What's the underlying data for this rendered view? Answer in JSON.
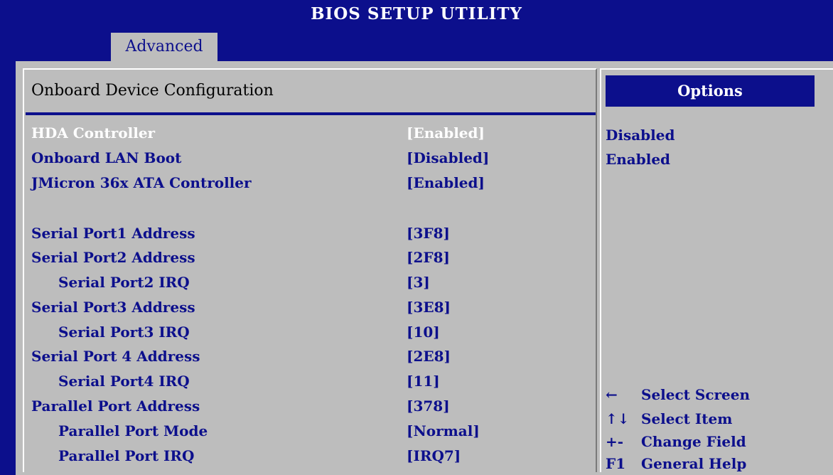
{
  "header": {
    "title": "BIOS SETUP UTILITY"
  },
  "tabs": [
    {
      "label": "Advanced"
    }
  ],
  "main": {
    "title": "Onboard Device Configuration",
    "items": [
      {
        "label": "HDA Controller",
        "value": "[Enabled]"
      },
      {
        "label": "Onboard LAN Boot",
        "value": "[Disabled]"
      },
      {
        "label": "JMicron 36x ATA Controller",
        "value": "[Enabled]"
      },
      {
        "label": "Serial Port1 Address",
        "value": "[3F8]"
      },
      {
        "label": "Serial Port2 Address",
        "value": "[2F8]"
      },
      {
        "label": "Serial Port2 IRQ",
        "value": "[3]"
      },
      {
        "label": "Serial Port3 Address",
        "value": "[3E8]"
      },
      {
        "label": "Serial Port3 IRQ",
        "value": "[10]"
      },
      {
        "label": "Serial Port 4 Address",
        "value": "[2E8]"
      },
      {
        "label": "Serial Port4 IRQ",
        "value": "[11]"
      },
      {
        "label": "Parallel Port Address",
        "value": "[378]"
      },
      {
        "label": "Parallel Port Mode",
        "value": "[Normal]"
      },
      {
        "label": "Parallel Port IRQ",
        "value": "[IRQ7]"
      }
    ]
  },
  "options": {
    "header": "Options",
    "choices": [
      "Disabled",
      "Enabled"
    ]
  },
  "help": [
    {
      "key": "←",
      "text": "Select Screen"
    },
    {
      "key": "↑↓",
      "text": "Select Item"
    },
    {
      "key": "+-",
      "text": "Change Field"
    },
    {
      "key": "F1",
      "text": "General Help"
    }
  ],
  "colors": {
    "background": "#0c0f8c",
    "panel": "#bdbdbd",
    "highlight": "#ffffff"
  }
}
